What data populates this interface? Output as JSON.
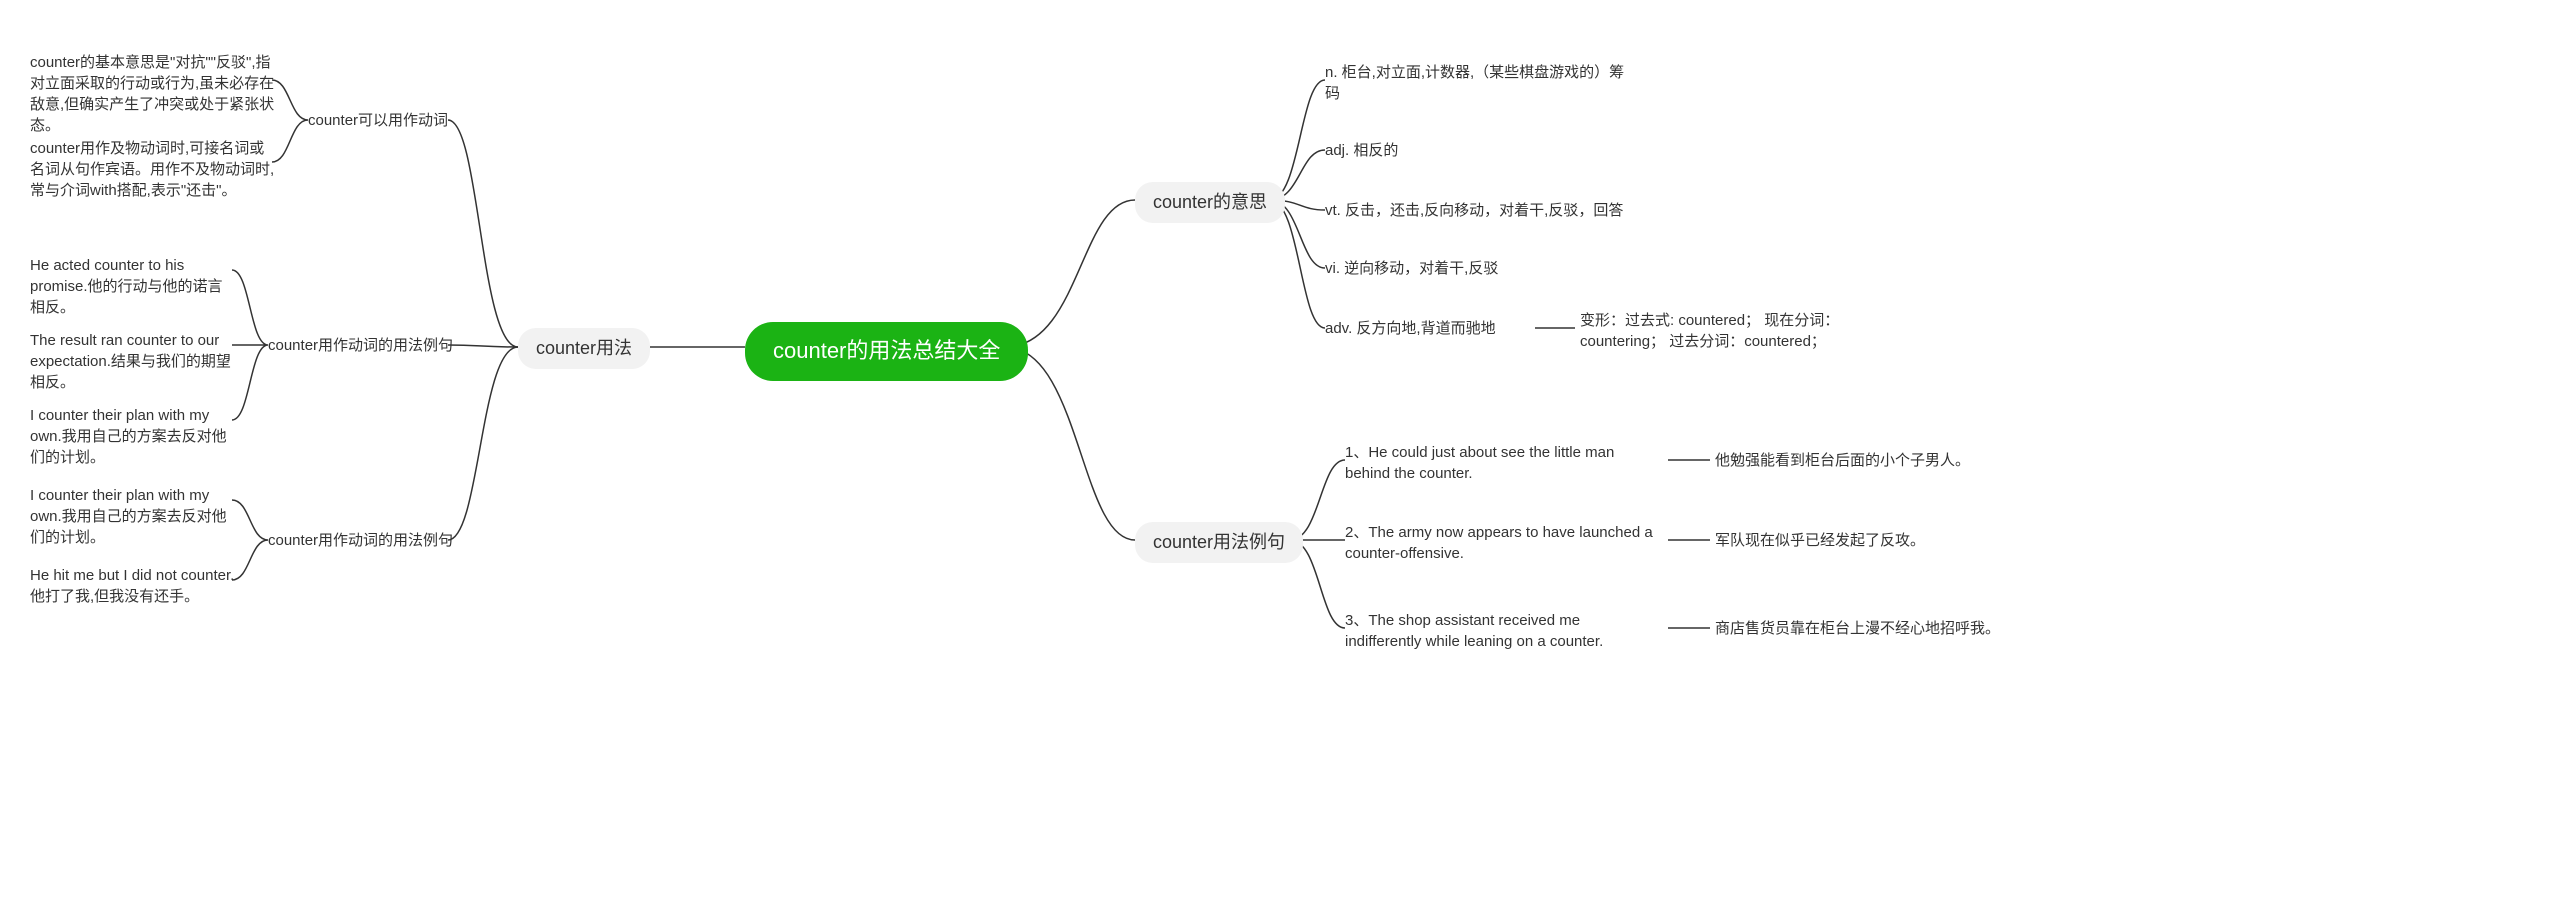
{
  "root": "counter的用法总结大全",
  "left": {
    "usage": "counter用法",
    "verb_usage": "counter可以用作动词",
    "verb_desc_1": "counter的基本意思是\"对抗\"\"反驳\",指对立面采取的行动或行为,虽未必存在敌意,但确实产生了冲突或处于紧张状态。",
    "verb_desc_2": "counter用作及物动词时,可接名词或名词从句作宾语。用作不及物动词时,常与介词with搭配,表示\"还击\"。",
    "sentence_group_1": "counter用作动词的用法例句",
    "sent_1_1": "He acted counter to his promise.他的行动与他的诺言相反。",
    "sent_1_2": "The result ran counter to our expectation.结果与我们的期望相反。",
    "sent_1_3": "I counter their plan with my own.我用自己的方案去反对他们的计划。",
    "sentence_group_2": "counter用作动词的用法例句",
    "sent_2_1": "I counter their plan with my own.我用自己的方案去反对他们的计划。",
    "sent_2_2": "He hit me but I did not counter.他打了我,但我没有还手。"
  },
  "right": {
    "meaning": "counter的意思",
    "mean_1": "n. 柜台,对立面,计数器,（某些棋盘游戏的）筹码",
    "mean_2": "adj. 相反的",
    "mean_3": "vt. 反击，还击,反向移动，对着干,反驳，回答",
    "mean_4": "vi. 逆向移动，对着干,反驳",
    "mean_5": "adv. 反方向地,背道而驰地",
    "mean_5_extra": "变形：过去式: countered； 现在分词：countering； 过去分词：countered；",
    "sentences": "counter用法例句",
    "r_sent_1": "1、He could just about see the little man behind the counter.",
    "r_sent_1_t": "他勉强能看到柜台后面的小个子男人。",
    "r_sent_2": "2、The army now appears to have launched a counter-offensive.",
    "r_sent_2_t": "军队现在似乎已经发起了反攻。",
    "r_sent_3": "3、The shop assistant received me indifferently while leaning on a counter.",
    "r_sent_3_t": "商店售货员靠在柜台上漫不经心地招呼我。"
  }
}
